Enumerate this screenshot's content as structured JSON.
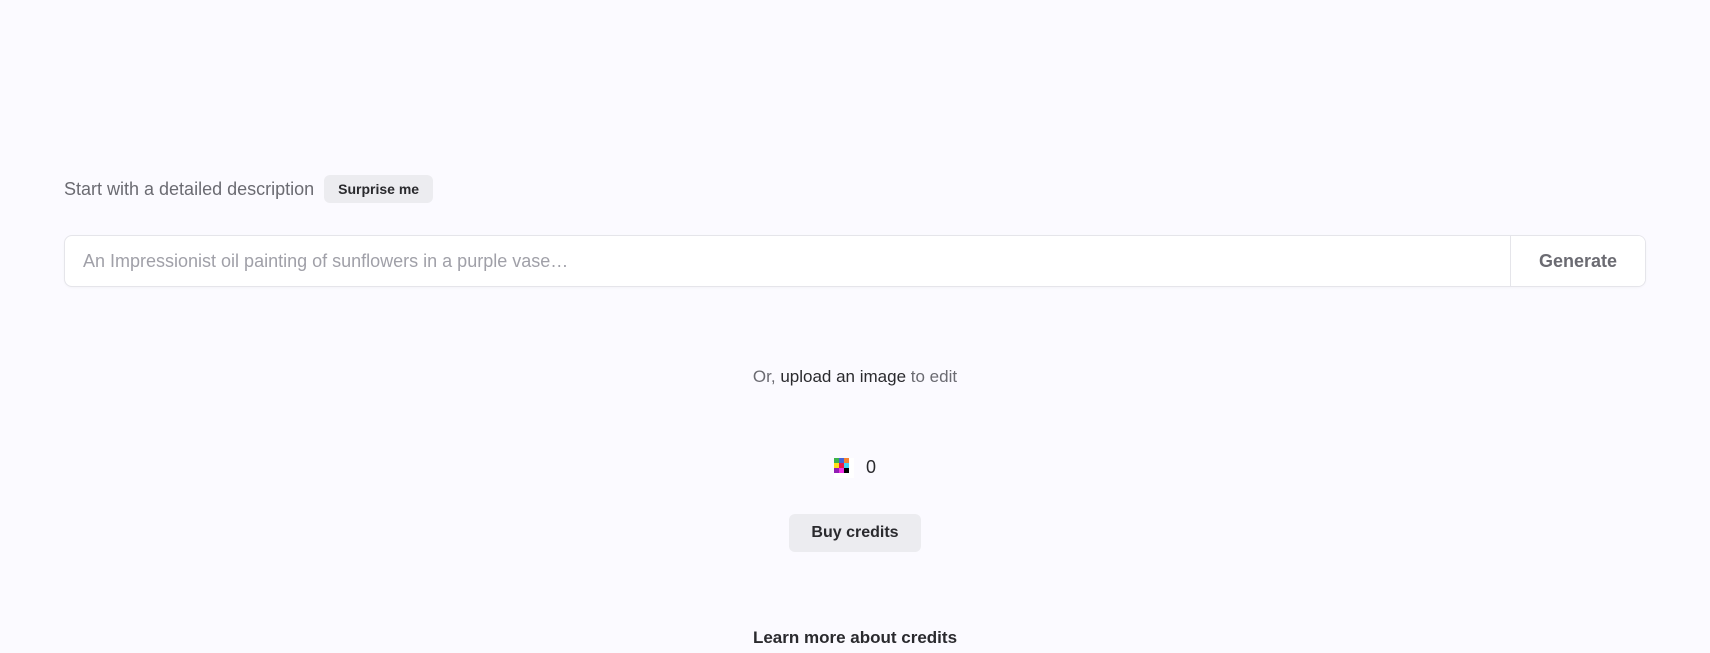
{
  "header": {
    "description_text": "Start with a detailed description",
    "surprise_button_label": "Surprise me"
  },
  "prompt": {
    "placeholder": "An Impressionist oil painting of sunflowers in a purple vase…",
    "value": "",
    "generate_button_label": "Generate"
  },
  "upload": {
    "prefix": "Or, ",
    "link_text": "upload an image",
    "suffix": " to edit"
  },
  "credits": {
    "count": "0",
    "buy_button_label": "Buy credits",
    "learn_more_label": "Learn more about credits"
  }
}
